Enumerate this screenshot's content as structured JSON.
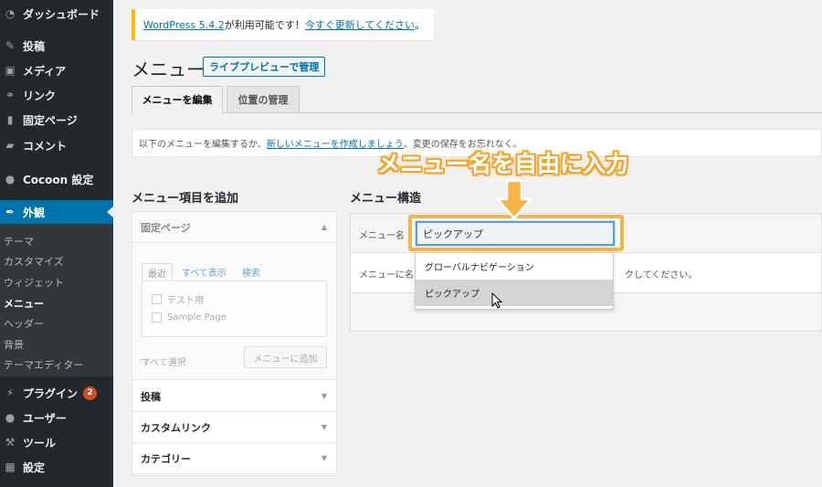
{
  "sidebar": {
    "items": [
      {
        "label": "ダッシュボード",
        "icon": "dashboard-icon",
        "glyph": "◔"
      },
      {
        "label": "投稿",
        "icon": "pin-icon",
        "glyph": "✎"
      },
      {
        "label": "メディア",
        "icon": "media-icon",
        "glyph": "▣"
      },
      {
        "label": "リンク",
        "icon": "link-icon",
        "glyph": "⚭"
      },
      {
        "label": "固定ページ",
        "icon": "page-icon",
        "glyph": "▮"
      },
      {
        "label": "コメント",
        "icon": "comment-icon",
        "glyph": "▰"
      },
      {
        "label": "Cocoon 設定",
        "icon": "cocoon-icon",
        "glyph": "●"
      },
      {
        "label": "外観",
        "icon": "appearance-icon",
        "glyph": "✒"
      },
      {
        "label": "プラグイン",
        "icon": "plugin-icon",
        "glyph": "⚡",
        "badge": "2"
      },
      {
        "label": "ユーザー",
        "icon": "user-icon",
        "glyph": "●"
      },
      {
        "label": "ツール",
        "icon": "tool-icon",
        "glyph": "⚒"
      },
      {
        "label": "設定",
        "icon": "settings-icon",
        "glyph": "▦"
      }
    ],
    "submenu": [
      "テーマ",
      "カスタマイズ",
      "ウィジェット",
      "メニュー",
      "ヘッダー",
      "背景",
      "テーマエディター"
    ]
  },
  "notice": {
    "link1": "WordPress 5.4.2",
    "text": " が利用可能です！",
    "link2": "今すぐ更新してください",
    "end": "。"
  },
  "header": {
    "title": "メニュー",
    "live_preview": "ライブプレビューで管理"
  },
  "tabs": [
    "メニューを編集",
    "位置の管理"
  ],
  "info": {
    "pre": "以下のメニューを編集するか、",
    "link": "新しいメニューを作成しましょう",
    "post": "。変更の保存をお忘れなく。"
  },
  "left": {
    "heading": "メニュー項目を追加",
    "accordions": [
      "固定ページ",
      "投稿",
      "カスタムリンク",
      "カテゴリー"
    ],
    "inner_tabs": [
      "最近",
      "すべて表示",
      "検索"
    ],
    "items": [
      "テスト用",
      "Sample Page"
    ],
    "select_all": "すべて選択",
    "add_button": "メニューに追加"
  },
  "right": {
    "heading": "メニュー構造",
    "name_label": "メニュー名",
    "name_value": "ピックアップ",
    "desc_pre": "メニューに名",
    "desc_post": "クしてください。",
    "dropdown": [
      "グローバルナビゲーション",
      "ピックアップ"
    ]
  },
  "annotation": {
    "text": "メニュー名を自由に入力"
  },
  "colors": {
    "sidebar_bg": "#23282d",
    "active": "#0073aa",
    "annotation": "#f3a32b",
    "notice_border": "#ffb900"
  }
}
